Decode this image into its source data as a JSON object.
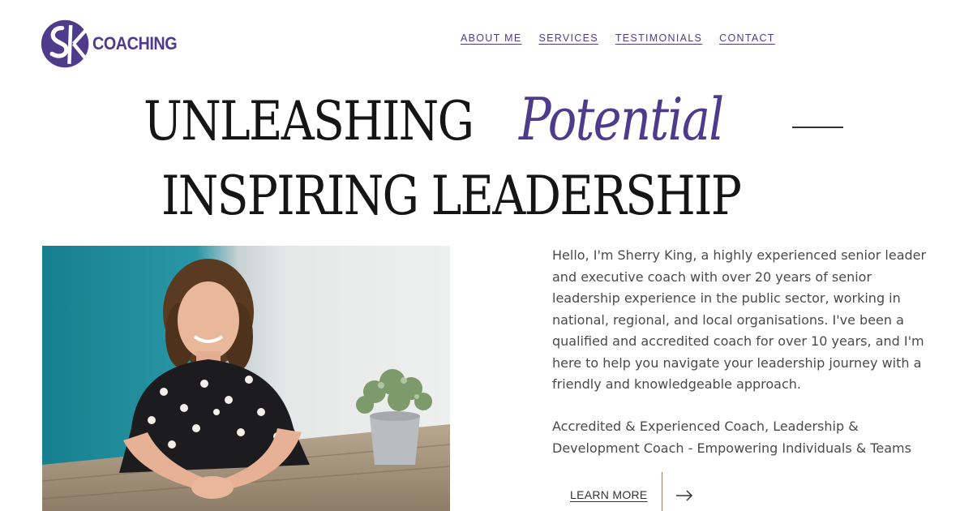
{
  "brand": {
    "logo_letters": "SK",
    "name": "COACHING",
    "color": "#4f3b8c"
  },
  "nav": {
    "items": [
      {
        "label": "ABOUT ME"
      },
      {
        "label": "SERVICES"
      },
      {
        "label": "TESTIMONIALS"
      },
      {
        "label": "CONTACT"
      }
    ]
  },
  "hero": {
    "line1": "UNLEASHING",
    "accent_word": "Potential",
    "line2": "INSPIRING LEADERSHIP",
    "accent_color": "#4f3b8c"
  },
  "bio": {
    "text": "Hello, I'm Sherry King, a highly experienced senior leader and executive coach with over 20 years of senior leadership experience in the public sector, working in national, regional, and local organisations. I've been a qualified and accredited coach for over 10 years, and I'm here to help you navigate your leadership journey with a friendly and knowledgeable approach.",
    "tagline": "Accredited & Experienced Coach, Leadership & Development Coach - Empowering Individuals & Teams"
  },
  "cta": {
    "label": "LEARN MORE",
    "icon": "arrow-right-icon"
  }
}
